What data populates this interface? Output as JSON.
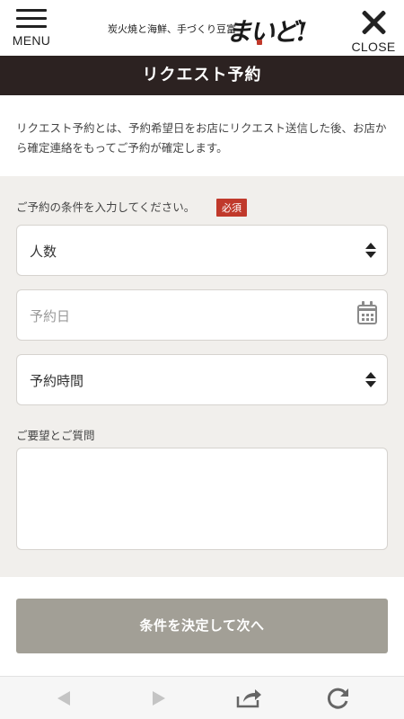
{
  "header": {
    "menu_label": "MENU",
    "close_label": "CLOSE",
    "brand_tagline": "炭火焼と海鮮、手づくり豆富",
    "brand_logo": "まいど!"
  },
  "page_title": "リクエスト予約",
  "intro_text": "リクエスト予約とは、予約希望日をお店にリクエスト送信した後、お店から確定連絡をもってご予約が確定します。",
  "form": {
    "conditions_label": "ご予約の条件を入力してください。",
    "required_badge": "必須",
    "party_size": {
      "value": "人数"
    },
    "date": {
      "placeholder": "予約日"
    },
    "time": {
      "value": "予約時間"
    },
    "request_label": "ご要望とご質問",
    "request_value": ""
  },
  "submit_label": "条件を決定して次へ",
  "colors": {
    "title_bar": "#2c2221",
    "form_background": "#f1efec",
    "required_badge": "#c0392b",
    "submit_button": "#a29f96"
  },
  "icons": {
    "menu": "hamburger-icon",
    "close": "close-icon",
    "party_size": "updown-arrows-icon",
    "date": "calendar-icon",
    "time": "updown-arrows-icon",
    "back": "back-arrow-icon",
    "forward": "forward-arrow-icon",
    "share": "share-icon",
    "reload": "reload-icon"
  }
}
